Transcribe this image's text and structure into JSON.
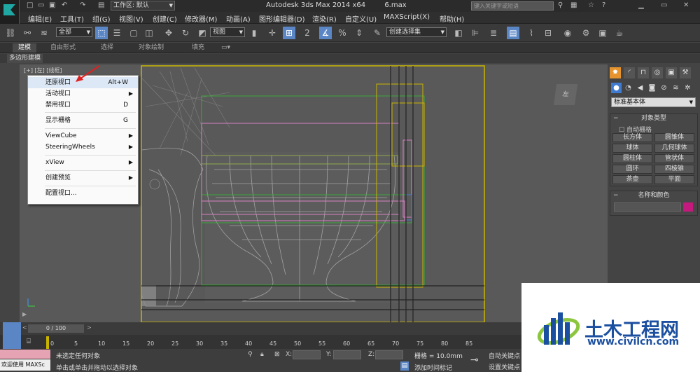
{
  "window": {
    "workspace": "工作区: 默认",
    "app_title": "Autodesk 3ds Max  2014 x64",
    "file": "6.max",
    "search_placeholder": "键入关键字或短语"
  },
  "menus": [
    "编辑(E)",
    "工具(T)",
    "组(G)",
    "视图(V)",
    "创建(C)",
    "修改器(M)",
    "动画(A)",
    "图形编辑器(D)",
    "渲染(R)",
    "自定义(U)",
    "MAXScript(X)",
    "帮助(H)"
  ],
  "toolbar": {
    "selection_filter": "全部",
    "ref_coord": "视图",
    "selection_set": "创建选择集"
  },
  "ribbon": {
    "tabs": [
      "建模",
      "自由形式",
      "选择",
      "对象绘制",
      "填充"
    ],
    "active": "建模",
    "sub": "多边形建模"
  },
  "viewport": {
    "label": "[+] [左] [线框]"
  },
  "context_menu": [
    {
      "label": "还原视口",
      "shortcut": "Alt+W"
    },
    {
      "label": "活动视口",
      "shortcut": ""
    },
    {
      "label": "禁用视口",
      "shortcut": "D"
    },
    {
      "label": "显示栅格",
      "shortcut": "G"
    },
    {
      "label": "ViewCube",
      "shortcut": ""
    },
    {
      "label": "SteeringWheels",
      "shortcut": ""
    },
    {
      "label": "xView",
      "shortcut": ""
    },
    {
      "label": "创建预览",
      "shortcut": ""
    },
    {
      "label": "配置视口...",
      "shortcut": ""
    }
  ],
  "command_panel": {
    "category": "标准基本体",
    "object_type_title": "对象类型",
    "autogrid": "自动栅格",
    "buttons": [
      "长方体",
      "圆锥体",
      "球体",
      "几何球体",
      "圆柱体",
      "管状体",
      "圆环",
      "四棱锥",
      "茶壶",
      "平面"
    ],
    "name_color_title": "名称和颜色",
    "object_color": "#c41a7d"
  },
  "timeline": {
    "frame": "0 / 100",
    "ticks": [
      "0",
      "5",
      "10",
      "15",
      "20",
      "25",
      "30",
      "35",
      "40",
      "45",
      "50",
      "55",
      "60",
      "65",
      "70",
      "75",
      "80",
      "85"
    ]
  },
  "status": {
    "selection": "未选定任何对象",
    "prompt": "单击或单击并拖动以选择对象",
    "x_label": "X:",
    "y_label": "Y:",
    "z_label": "Z:",
    "grid": "栅格 = 10.0mm",
    "add_time_tag": "添加时间标记",
    "auto_key": "自动关键点",
    "set_key": "设置关键点",
    "maxscript": "欢迎使用 MAXSc"
  },
  "watermark": {
    "title": "土木工程网",
    "url": "www.civilcn.com"
  }
}
